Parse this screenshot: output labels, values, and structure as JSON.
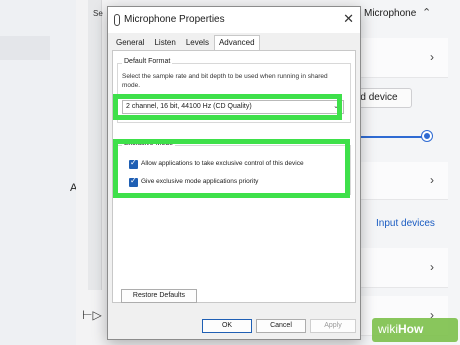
{
  "background": {
    "section_title": "Microphone",
    "add_label": "Ad",
    "truncated_label": "Se",
    "button_label": "d device",
    "input_devices_link": "Input devices",
    "adjust_icon": "sliders-icon"
  },
  "dialog": {
    "title": "Microphone Properties",
    "tabs": [
      {
        "label": "General",
        "active": false
      },
      {
        "label": "Listen",
        "active": false
      },
      {
        "label": "Levels",
        "active": false
      },
      {
        "label": "Advanced",
        "active": true
      }
    ],
    "default_format": {
      "group_label": "Default Format",
      "description": "Select the sample rate and bit depth to be used when running in shared mode.",
      "selected_value": "2 channel, 16 bit, 44100 Hz (CD Quality)"
    },
    "exclusive_mode": {
      "group_label": "Exclusive Mode",
      "options": [
        {
          "label": "Allow applications to take exclusive control of this device",
          "checked": true
        },
        {
          "label": "Give exclusive mode applications priority",
          "checked": true
        }
      ]
    },
    "restore_defaults": "Restore Defaults",
    "ok": "OK",
    "cancel": "Cancel",
    "apply": "Apply"
  },
  "colors": {
    "highlight": "#3ee04a",
    "accent": "#1f5fb4",
    "link": "#1a5cc2"
  },
  "watermark": {
    "prefix": "wiki",
    "suffix": "How"
  }
}
